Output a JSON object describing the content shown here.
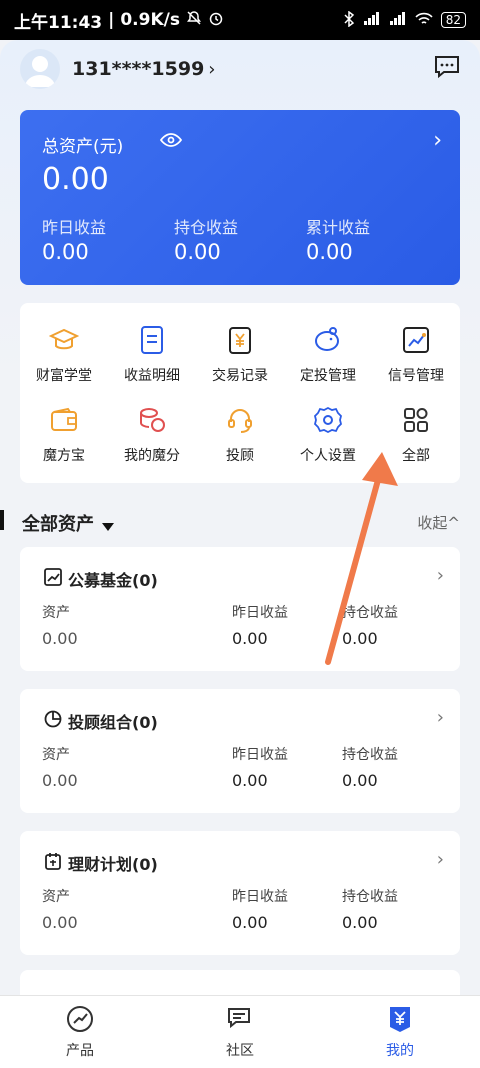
{
  "status_bar": {
    "time": "上午11:43",
    "speed": "0.9K/s",
    "battery": "82"
  },
  "profile": {
    "username": "131****1599",
    "arrow": "›"
  },
  "asset": {
    "label": "总资产(元)",
    "total": "0.00",
    "chevron": "›",
    "yesterday_label": "昨日收益",
    "yesterday_value": "0.00",
    "holding_label": "持仓收益",
    "holding_value": "0.00",
    "cumulative_label": "累计收益",
    "cumulative_value": "0.00"
  },
  "menu": [
    {
      "label": "财富学堂",
      "icon": "graduation-cap-icon"
    },
    {
      "label": "收益明细",
      "icon": "document-icon"
    },
    {
      "label": "交易记录",
      "icon": "yuan-receipt-icon"
    },
    {
      "label": "定投管理",
      "icon": "piggy-bank-icon"
    },
    {
      "label": "信号管理",
      "icon": "chart-signal-icon"
    },
    {
      "label": "魔方宝",
      "icon": "wallet-icon"
    },
    {
      "label": "我的魔分",
      "icon": "coins-icon"
    },
    {
      "label": "投顾",
      "icon": "headset-icon"
    },
    {
      "label": "个人设置",
      "icon": "gear-icon"
    },
    {
      "label": "全部",
      "icon": "grid-icon"
    }
  ],
  "section": {
    "title": "全部资产",
    "collapse": "收起^"
  },
  "funds": [
    {
      "title": "公募基金(0)",
      "icon": "trend-icon",
      "asset_label": "资产",
      "asset": "0.00",
      "yesterday_label": "昨日收益",
      "yesterday": "0.00",
      "holding_label": "持仓收益",
      "holding": "0.00"
    },
    {
      "title": "投顾组合(0)",
      "icon": "pie-icon",
      "asset_label": "资产",
      "asset": "0.00",
      "yesterday_label": "昨日收益",
      "yesterday": "0.00",
      "holding_label": "持仓收益",
      "holding": "0.00"
    },
    {
      "title": "理财计划(0)",
      "icon": "calendar-icon",
      "asset_label": "资产",
      "asset": "0.00",
      "yesterday_label": "昨日收益",
      "yesterday": "0.00",
      "holding_label": "持仓收益",
      "holding": "0.00"
    }
  ],
  "tabs": [
    {
      "label": "产品",
      "icon": "trend-circle-icon"
    },
    {
      "label": "社区",
      "icon": "chat-icon"
    },
    {
      "label": "我的",
      "icon": "yuan-shield-icon",
      "active": true
    }
  ],
  "colors": {
    "accent": "#2b5ce6",
    "annotation_arrow": "#f07a4a"
  }
}
